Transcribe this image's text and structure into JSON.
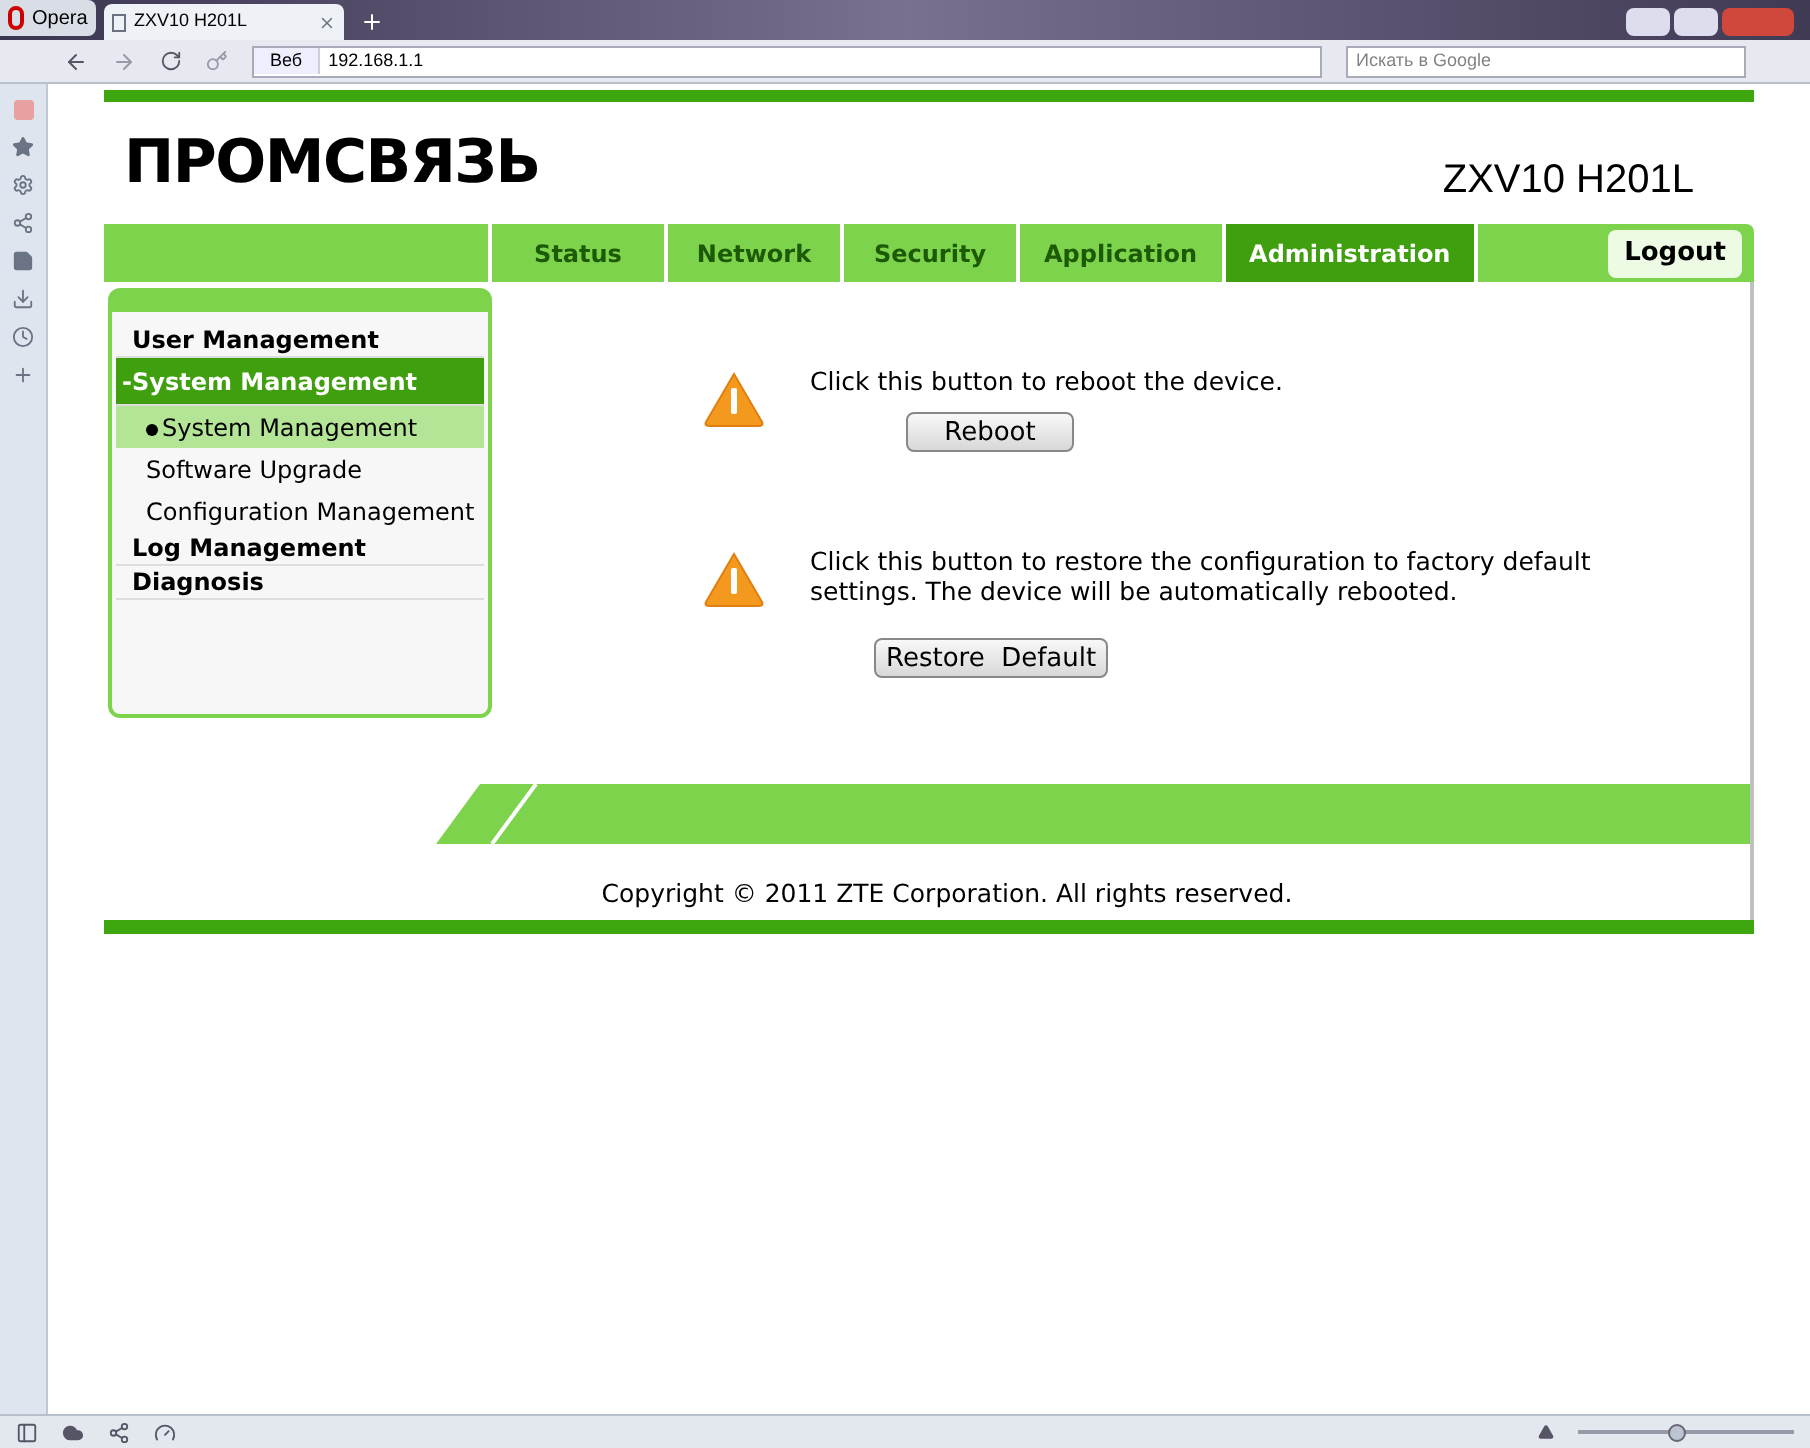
{
  "browser": {
    "menu_label": "Opera",
    "tab_title": "ZXV10 H201L",
    "address_prefix": "Веб",
    "address": "192.168.1.1",
    "search_placeholder": "Искать в Google",
    "zoom": {
      "level": 0.45
    }
  },
  "header": {
    "logo": "ПРОМСВЯЗЬ",
    "model": "ZXV10 H201L"
  },
  "nav": [
    {
      "label": "Status",
      "selected": false
    },
    {
      "label": "Network",
      "selected": false
    },
    {
      "label": "Security",
      "selected": false
    },
    {
      "label": "Application",
      "selected": false
    },
    {
      "label": "Administration",
      "selected": true
    }
  ],
  "logout": "Logout",
  "menu": [
    {
      "label": "User Management",
      "expanded": false
    },
    {
      "label": "-System Management",
      "expanded": true,
      "children": [
        {
          "label": "System Management",
          "selected": true
        },
        {
          "label": "Software Upgrade",
          "selected": false
        },
        {
          "label": "Configuration Management",
          "selected": false
        }
      ]
    },
    {
      "label": "Log Management",
      "expanded": false
    },
    {
      "label": "Diagnosis",
      "expanded": false
    }
  ],
  "actions": [
    {
      "text": "Click this button to reboot the device.",
      "button": "Reboot"
    },
    {
      "text": "Click this button to restore the configuration to factory default settings. The device will be automatically rebooted.",
      "button": "Restore  Default"
    }
  ],
  "copyright": "Copyright © 2011 ZTE Corporation. All rights reserved."
}
